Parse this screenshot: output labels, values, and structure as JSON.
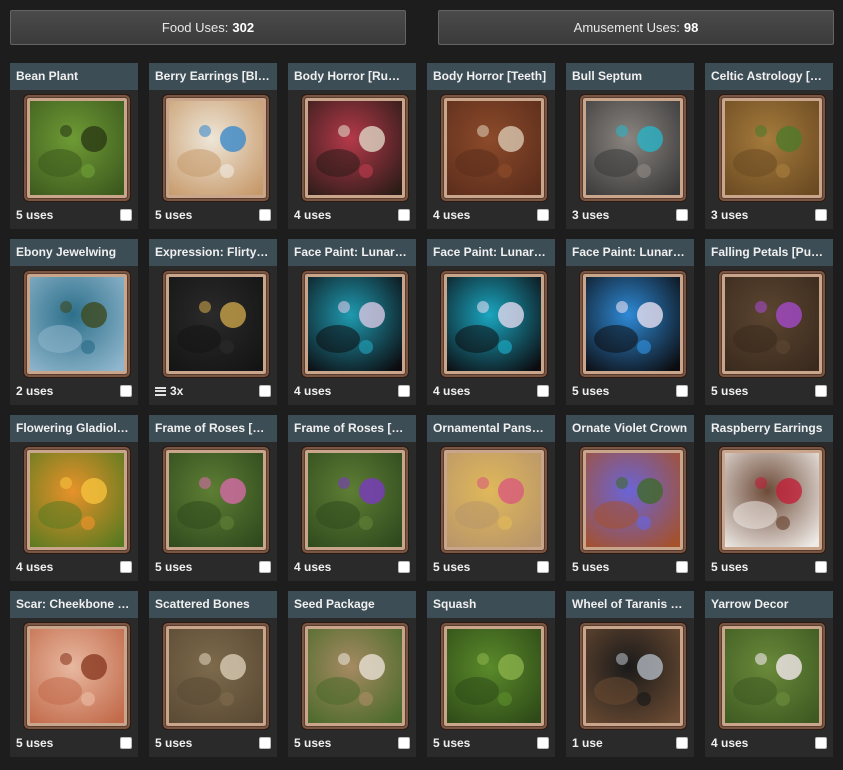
{
  "header": {
    "food_label": "Food Uses:",
    "food_value": "302",
    "amusement_label": "Amusement Uses:",
    "amusement_value": "98"
  },
  "colors": {
    "title_bar": "#3d4d56",
    "card_bg": "#2a2a2a",
    "frame": "#c9a58c"
  },
  "items": [
    {
      "name": "Bean Plant",
      "uses": "5 uses",
      "icon": "bean-plant",
      "colors": [
        "#3d5a1e",
        "#6e9b35",
        "#2a3a14"
      ]
    },
    {
      "name": "Berry Earrings [Blue]",
      "uses": "5 uses",
      "icon": "berry-earrings-blue",
      "colors": [
        "#c79a6b",
        "#eee6d8",
        "#3a8acb"
      ]
    },
    {
      "name": "Body Horror [Rump Spikes]",
      "uses": "4 uses",
      "icon": "rump-spikes",
      "colors": [
        "#2c1c18",
        "#b5394a",
        "#dfd4c4"
      ]
    },
    {
      "name": "Body Horror [Teeth]",
      "uses": "4 uses",
      "icon": "teeth",
      "colors": [
        "#5b2d1c",
        "#8c4a2a",
        "#d9c7b0"
      ]
    },
    {
      "name": "Bull Septum",
      "uses": "3 uses",
      "icon": "bull-septum",
      "colors": [
        "#3b3a3a",
        "#8a8580",
        "#2bb3c6"
      ]
    },
    {
      "name": "Celtic Astrology [Elder]",
      "uses": "3 uses",
      "icon": "celtic-astrology",
      "colors": [
        "#6b4a22",
        "#a57b3c",
        "#4f7a2a"
      ]
    },
    {
      "name": "Ebony Jewelwing",
      "uses": "2 uses",
      "icon": "dragonfly",
      "colors": [
        "#8fb6cc",
        "#2d6f8a",
        "#3d4a1e"
      ]
    },
    {
      "name": "Expression: Flirty [Black]",
      "uses": "3x",
      "stacked": true,
      "icon": "expression-flirty",
      "colors": [
        "#141414",
        "#2a2a2a",
        "#c9a24a"
      ]
    },
    {
      "name": "Face Paint: Lunar Crescent",
      "uses": "4 uses",
      "icon": "face-paint-1",
      "colors": [
        "#0c0c10",
        "#1f9ab0",
        "#d8c7e4"
      ]
    },
    {
      "name": "Face Paint: Lunar Dime",
      "uses": "4 uses",
      "icon": "face-paint-2",
      "colors": [
        "#0c0c10",
        "#1aa6c0",
        "#e0d8ee"
      ]
    },
    {
      "name": "Face Paint: Lunar Sun",
      "uses": "5 uses",
      "icon": "face-paint-3",
      "colors": [
        "#0c0c10",
        "#2e8ad6",
        "#e6e0f0"
      ]
    },
    {
      "name": "Falling Petals [Purple]",
      "uses": "5 uses",
      "icon": "falling-petals",
      "colors": [
        "#3a2a1e",
        "#5b4530",
        "#a44ac9"
      ]
    },
    {
      "name": "Flowering Gladiolus [Orange]",
      "uses": "4 uses",
      "icon": "gladiolus",
      "colors": [
        "#5a7a20",
        "#e8922a",
        "#f6c23c"
      ]
    },
    {
      "name": "Frame of Roses [Pink]",
      "uses": "5 uses",
      "icon": "roses-pink",
      "colors": [
        "#2f4a1e",
        "#5e7e34",
        "#d46aa6"
      ]
    },
    {
      "name": "Frame of Roses [Violet]",
      "uses": "4 uses",
      "icon": "roses-violet",
      "colors": [
        "#2f4a1e",
        "#5e7e34",
        "#7a3ac0"
      ]
    },
    {
      "name": "Ornamental Pansy Crown",
      "uses": "5 uses",
      "icon": "pansy-crown",
      "colors": [
        "#b8956a",
        "#e0b85a",
        "#d85a7a"
      ]
    },
    {
      "name": "Ornate Violet Crown",
      "uses": "5 uses",
      "icon": "violet-crown",
      "colors": [
        "#a5512a",
        "#6a64d8",
        "#3e6a2a"
      ]
    },
    {
      "name": "Raspberry Earrings",
      "uses": "5 uses",
      "icon": "raspberry-earrings",
      "colors": [
        "#eeeae6",
        "#6d4a38",
        "#c0203a"
      ]
    },
    {
      "name": "Scar: Cheekbone [Right]",
      "uses": "5 uses",
      "icon": "scar-cheekbone",
      "colors": [
        "#c26a4a",
        "#e8b8a0",
        "#8a3a22"
      ]
    },
    {
      "name": "Scattered Bones",
      "uses": "5 uses",
      "icon": "scattered-bones",
      "colors": [
        "#5a4a34",
        "#7d6a4c",
        "#d8ccb4"
      ]
    },
    {
      "name": "Seed Package",
      "uses": "5 uses",
      "icon": "seed-package",
      "colors": [
        "#4a6a2a",
        "#a58a62",
        "#e8e0d4"
      ]
    },
    {
      "name": "Squash",
      "uses": "5 uses",
      "icon": "squash",
      "colors": [
        "#2e4a18",
        "#5a8a2a",
        "#8ab04a"
      ]
    },
    {
      "name": "Wheel of Taranis Bonnet",
      "uses": "1 use",
      "icon": "taranis-bonnet",
      "colors": [
        "#6a4a32",
        "#1a1a1a",
        "#b0b8c0"
      ]
    },
    {
      "name": "Yarrow Decor",
      "uses": "4 uses",
      "icon": "yarrow-decor",
      "colors": [
        "#3e5a22",
        "#6a8a3a",
        "#f2e8ec"
      ]
    }
  ]
}
